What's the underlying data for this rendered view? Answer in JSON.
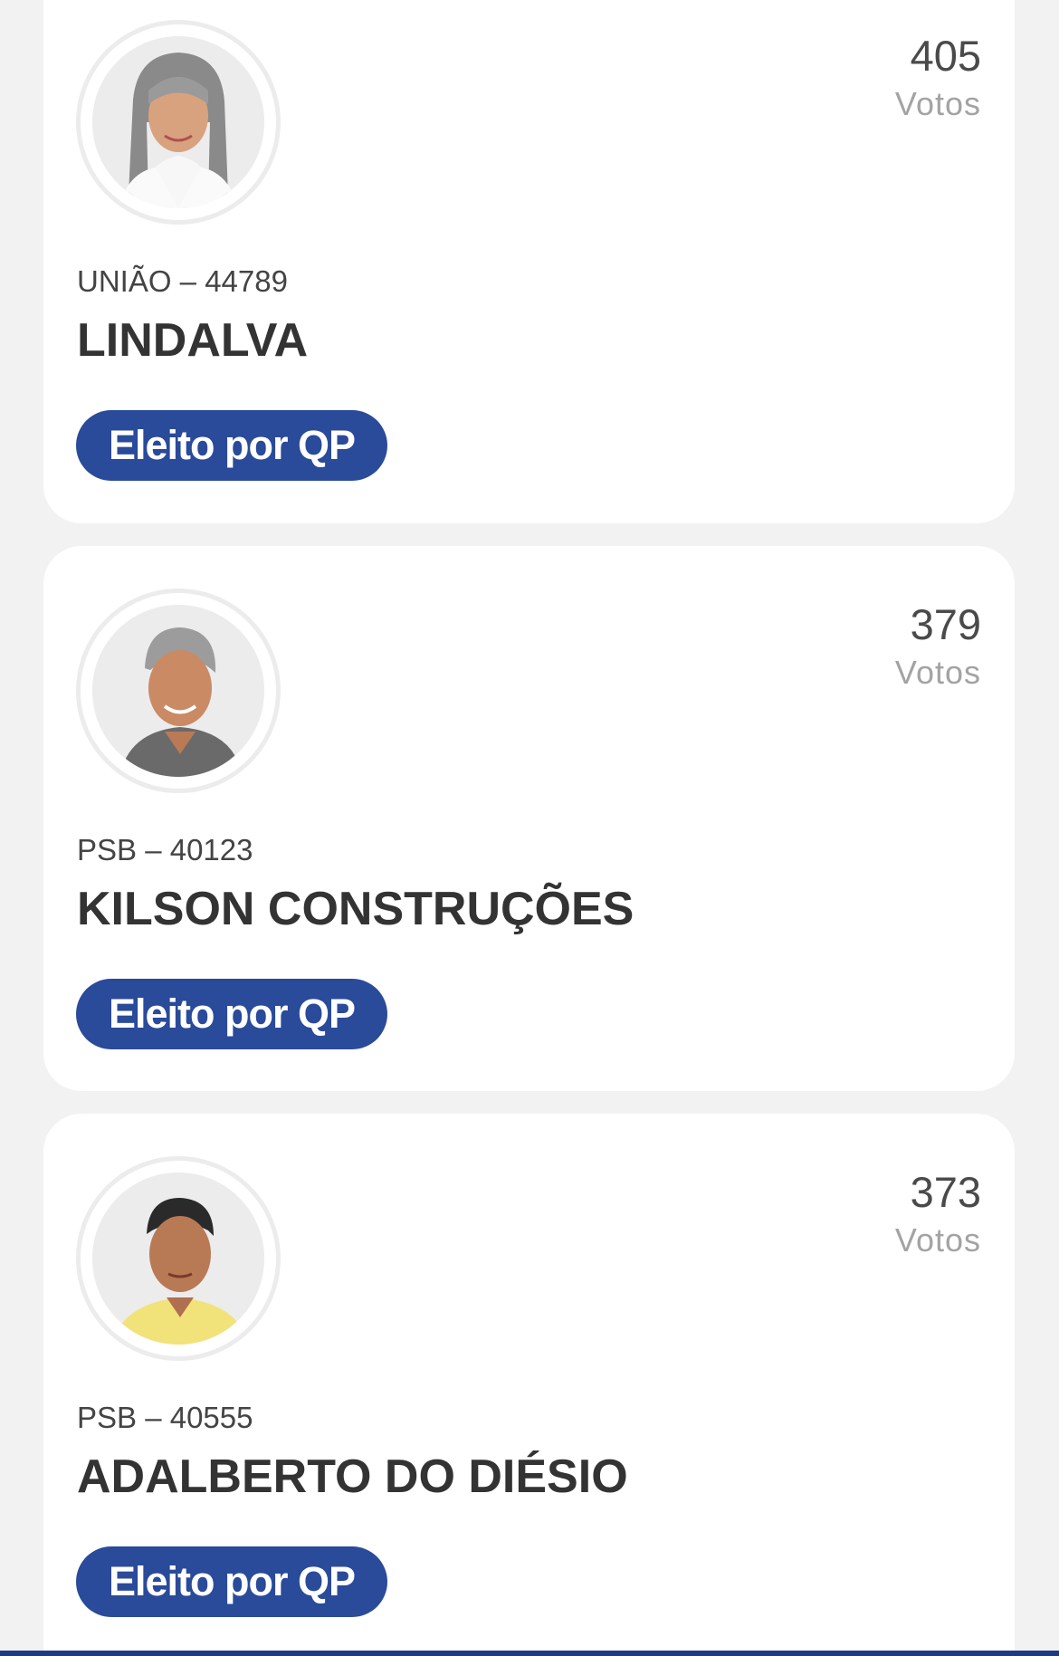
{
  "candidates": [
    {
      "party_number": "UNIÃO – 44789",
      "name": "LINDALVA",
      "votes": "405",
      "votes_label": "Votos",
      "status": "Eleito por QP"
    },
    {
      "party_number": "PSB – 40123",
      "name": "KILSON CONSTRUÇÕES",
      "votes": "379",
      "votes_label": "Votos",
      "status": "Eleito por QP"
    },
    {
      "party_number": "PSB – 40555",
      "name": "ADALBERTO DO DIÉSIO",
      "votes": "373",
      "votes_label": "Votos",
      "status": "Eleito por QP"
    }
  ],
  "colors": {
    "badge_background": "#2a4a9a",
    "badge_text": "#ffffff",
    "page_background": "#f2f2f2",
    "card_background": "#ffffff"
  }
}
